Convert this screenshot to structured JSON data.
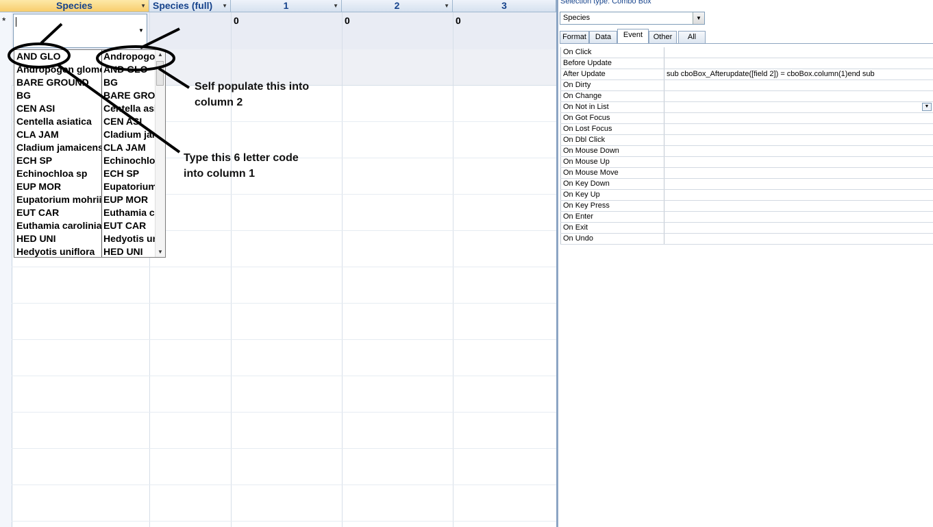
{
  "datasheet": {
    "headers": [
      {
        "label": "Species"
      },
      {
        "label": "Species (full)"
      },
      {
        "label": "1"
      },
      {
        "label": "2"
      },
      {
        "label": "3"
      }
    ],
    "new_row_marker": "*",
    "new_row_values": [
      "0",
      "0",
      "0"
    ]
  },
  "combo_list": {
    "items": [
      {
        "code": "AND GLO",
        "full": "Andropogon glomeratus"
      },
      {
        "code": "Andropogon glomeratus",
        "full": "AND GLO"
      },
      {
        "code": "BARE GROUND",
        "full": "BG"
      },
      {
        "code": "BG",
        "full": "BARE GROUND"
      },
      {
        "code": "CEN ASI",
        "full": "Centella asiatica"
      },
      {
        "code": "Centella asiatica",
        "full": "CEN ASI"
      },
      {
        "code": "CLA JAM",
        "full": "Cladium jamaicense"
      },
      {
        "code": "Cladium jamaicense",
        "full": "CLA JAM"
      },
      {
        "code": "ECH SP",
        "full": "Echinochloa sp"
      },
      {
        "code": "Echinochloa sp",
        "full": "ECH SP"
      },
      {
        "code": "EUP MOR",
        "full": "Eupatorium mohrii"
      },
      {
        "code": "Eupatorium mohrii",
        "full": "EUP MOR"
      },
      {
        "code": "EUT CAR",
        "full": "Euthamia caroliniana"
      },
      {
        "code": "Euthamia caroliniana",
        "full": "EUT CAR"
      },
      {
        "code": "HED UNI",
        "full": "Hedyotis uniflora"
      },
      {
        "code": "Hedyotis uniflora",
        "full": "HED UNI"
      }
    ]
  },
  "annotations": {
    "self_populate": "Self populate this into\ncolumn 2",
    "type_code": "Type this 6 letter code\ninto column 1"
  },
  "property_sheet": {
    "selection_type": "Selection type:  Combo Box",
    "object": "Species",
    "tabs": [
      "Format",
      "Data",
      "Event",
      "Other",
      "All"
    ],
    "active_tab": "Event",
    "rows": [
      {
        "name": "On Click",
        "value": ""
      },
      {
        "name": "Before Update",
        "value": ""
      },
      {
        "name": "After Update",
        "value": "sub cboBox_Afterupdate([field 2]) = cboBox.column(1)end sub"
      },
      {
        "name": "On Dirty",
        "value": ""
      },
      {
        "name": "On Change",
        "value": ""
      },
      {
        "name": "On Not in List",
        "value": ""
      },
      {
        "name": "On Got Focus",
        "value": ""
      },
      {
        "name": "On Lost Focus",
        "value": ""
      },
      {
        "name": "On Dbl Click",
        "value": ""
      },
      {
        "name": "On Mouse Down",
        "value": ""
      },
      {
        "name": "On Mouse Up",
        "value": ""
      },
      {
        "name": "On Mouse Move",
        "value": ""
      },
      {
        "name": "On Key Down",
        "value": ""
      },
      {
        "name": "On Key Up",
        "value": ""
      },
      {
        "name": "On Key Press",
        "value": ""
      },
      {
        "name": "On Enter",
        "value": ""
      },
      {
        "name": "On Exit",
        "value": ""
      },
      {
        "name": "On Undo",
        "value": ""
      }
    ]
  }
}
